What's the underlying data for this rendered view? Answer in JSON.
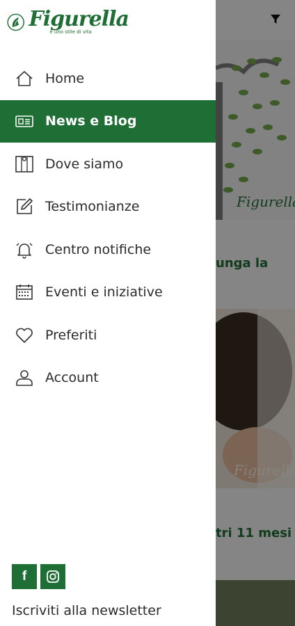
{
  "brand": {
    "name": "Figurella",
    "tagline": "è uno stile di vita",
    "color": "#1f6e36"
  },
  "menu": {
    "items": [
      {
        "label": "Home",
        "icon": "home-icon",
        "active": false
      },
      {
        "label": "News e Blog",
        "icon": "newspaper-icon",
        "active": true
      },
      {
        "label": "Dove siamo",
        "icon": "map-icon",
        "active": false
      },
      {
        "label": "Testimonianze",
        "icon": "edit-icon",
        "active": false
      },
      {
        "label": "Centro notifiche",
        "icon": "bell-icon",
        "active": false
      },
      {
        "label": "Eventi e iniziative",
        "icon": "calendar-icon",
        "active": false
      },
      {
        "label": "Preferiti",
        "icon": "heart-icon",
        "active": false
      },
      {
        "label": "Account",
        "icon": "user-icon",
        "active": false
      }
    ]
  },
  "social": {
    "facebook": "f",
    "instagram": "instagram-icon"
  },
  "footer": {
    "newsletter_label": "Iscriviti alla newsletter"
  },
  "background": {
    "card1_title": "unga la",
    "card2_title": "tri 11 mesi",
    "watermark": "Figurella"
  }
}
